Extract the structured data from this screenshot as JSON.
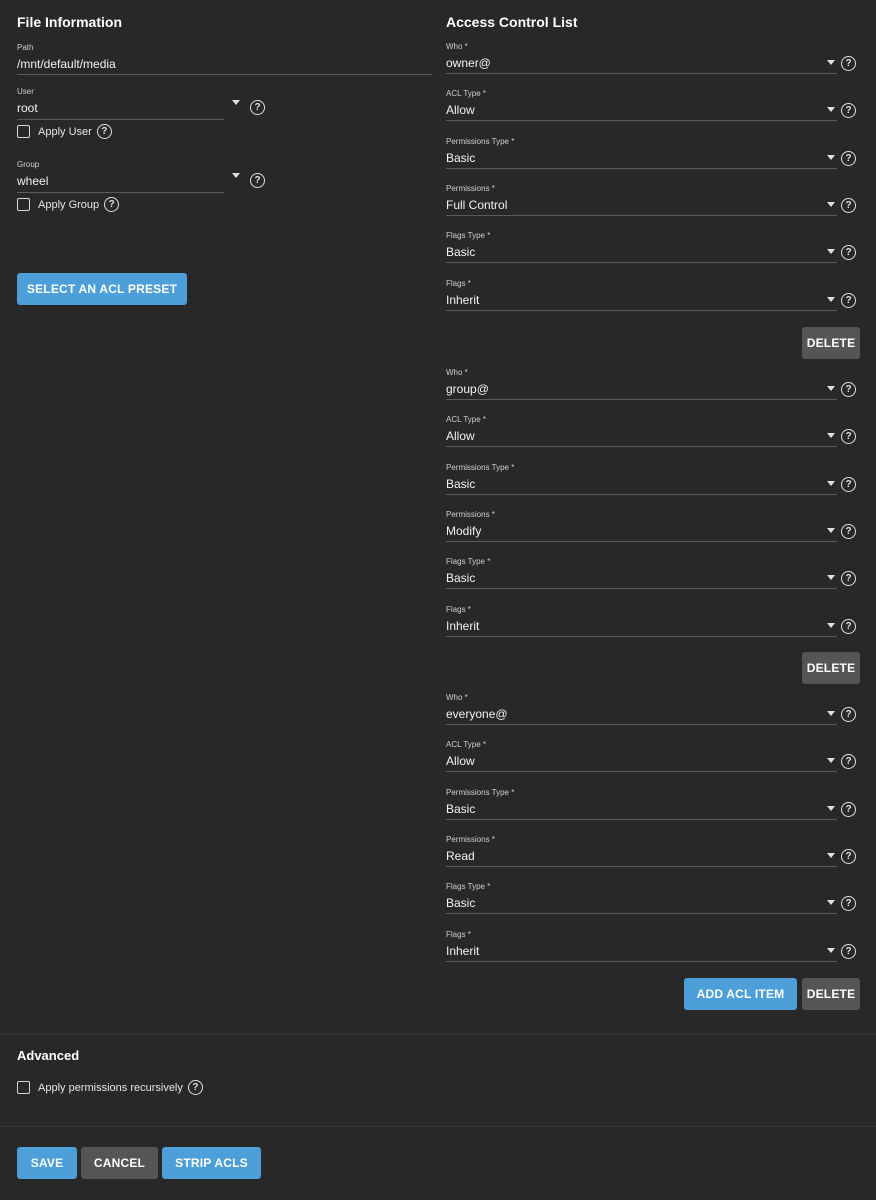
{
  "file_info": {
    "title": "File Information",
    "path": {
      "label": "Path",
      "value": "/mnt/default/media"
    },
    "user": {
      "label": "User",
      "value": "root",
      "apply_label": "Apply User"
    },
    "group": {
      "label": "Group",
      "value": "wheel",
      "apply_label": "Apply Group"
    },
    "preset_button": "SELECT AN ACL PRESET"
  },
  "acl": {
    "title": "Access Control List",
    "entries": [
      {
        "who": {
          "label": "Who *",
          "value": "owner@"
        },
        "acl_type": {
          "label": "ACL Type *",
          "value": "Allow"
        },
        "permissions_type": {
          "label": "Permissions Type *",
          "value": "Basic"
        },
        "permissions": {
          "label": "Permissions *",
          "value": "Full Control"
        },
        "flags_type": {
          "label": "Flags Type *",
          "value": "Basic"
        },
        "flags": {
          "label": "Flags *",
          "value": "Inherit"
        },
        "delete_label": "DELETE"
      },
      {
        "who": {
          "label": "Who *",
          "value": "group@"
        },
        "acl_type": {
          "label": "ACL Type *",
          "value": "Allow"
        },
        "permissions_type": {
          "label": "Permissions Type *",
          "value": "Basic"
        },
        "permissions": {
          "label": "Permissions *",
          "value": "Modify"
        },
        "flags_type": {
          "label": "Flags Type *",
          "value": "Basic"
        },
        "flags": {
          "label": "Flags *",
          "value": "Inherit"
        },
        "delete_label": "DELETE"
      },
      {
        "who": {
          "label": "Who *",
          "value": "everyone@"
        },
        "acl_type": {
          "label": "ACL Type *",
          "value": "Allow"
        },
        "permissions_type": {
          "label": "Permissions Type *",
          "value": "Basic"
        },
        "permissions": {
          "label": "Permissions *",
          "value": "Read"
        },
        "flags_type": {
          "label": "Flags Type *",
          "value": "Basic"
        },
        "flags": {
          "label": "Flags *",
          "value": "Inherit"
        },
        "delete_label": "DELETE"
      }
    ],
    "add_button": "ADD ACL ITEM"
  },
  "advanced": {
    "title": "Advanced",
    "recursive_label": "Apply permissions recursively"
  },
  "actions": {
    "save": "SAVE",
    "cancel": "CANCEL",
    "strip": "STRIP ACLS"
  },
  "help_glyph": "?",
  "colors": {
    "background": "#282828",
    "primary_button": "#4c9fd9",
    "secondary_button": "#555555"
  }
}
